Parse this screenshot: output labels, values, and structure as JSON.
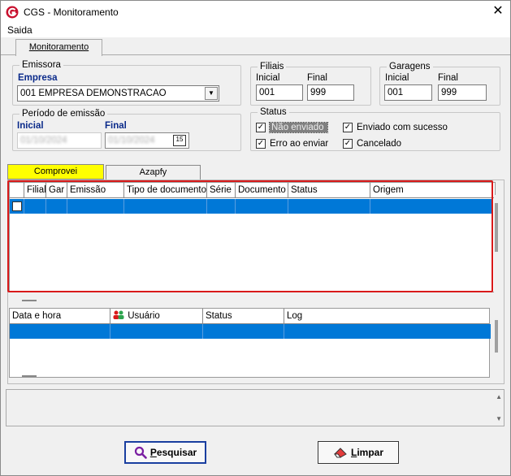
{
  "window": {
    "title": "CGS - Monitoramento",
    "close_glyph": "✕"
  },
  "menu": {
    "items": [
      "Saida"
    ]
  },
  "main_tab": {
    "label": "Monitoramento"
  },
  "emissora": {
    "legend": "Emissora",
    "empresa_label": "Empresa",
    "empresa_value": "001 EMPRESA DEMONSTRACAO"
  },
  "filiais": {
    "legend": "Filiais",
    "inicial_label": "Inicial",
    "final_label": "Final",
    "inicial_value": "001",
    "final_value": "999"
  },
  "garagens": {
    "legend": "Garagens",
    "inicial_label": "Inicial",
    "final_label": "Final",
    "inicial_value": "001",
    "final_value": "999"
  },
  "periodo": {
    "legend": "Período de emissão",
    "inicial_label": "Inicial",
    "final_label": "Final",
    "inicial_value": "01/10/2024",
    "final_value": "01/10/2024",
    "calendar_glyph": "15"
  },
  "status": {
    "legend": "Status",
    "options": [
      {
        "label": "Não enviado",
        "checked": true
      },
      {
        "label": "Enviado com sucesso",
        "checked": true
      },
      {
        "label": "Erro ao enviar",
        "checked": true
      },
      {
        "label": "Cancelado",
        "checked": true
      }
    ]
  },
  "sub_tabs": [
    {
      "label": "Comprovei",
      "active": true
    },
    {
      "label": "Azapfy",
      "active": false
    }
  ],
  "grid_top": {
    "columns": [
      "",
      "Filial",
      "Gar",
      "Emissão",
      "Tipo de documento",
      "Série",
      "Documento",
      "Status",
      "Origem"
    ]
  },
  "grid_bottom": {
    "columns": [
      "Data e hora",
      "Usuário",
      "Status",
      "Log"
    ]
  },
  "buttons": {
    "search_label_u": "P",
    "search_label_rest": "esquisar",
    "clear_label_u": "L",
    "clear_label_rest": "impar"
  },
  "colors": {
    "selection": "#0078d7",
    "active_tab": "#ffff00",
    "highlight": "#d9191a",
    "label_blue": "#0a2a8a"
  }
}
